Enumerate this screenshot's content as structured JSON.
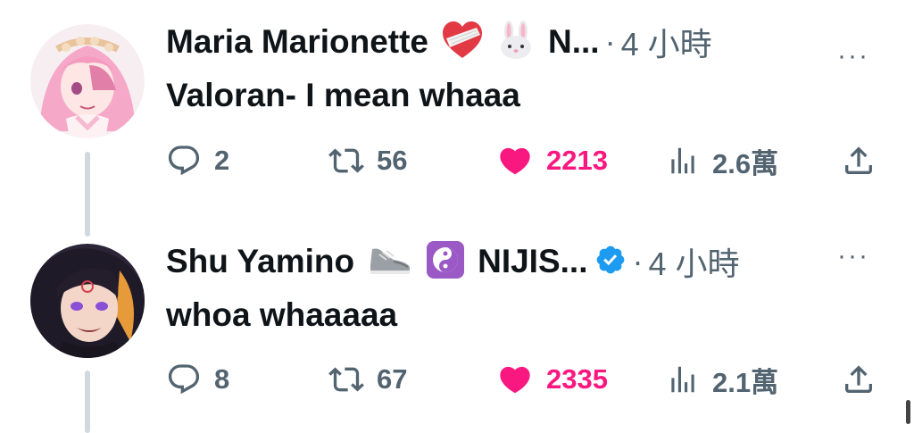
{
  "colors": {
    "like": "#f91880",
    "muted": "#536471",
    "verified": "#1d9bf0",
    "text": "#0f1419"
  },
  "tweets": [
    {
      "author": "Maria Marionette",
      "handle_truncated": "N...",
      "separator": "·",
      "time": "4 小時",
      "text": "Valoran- I mean whaaa",
      "reply_count": "2",
      "retweet_count": "56",
      "like_count": "2213",
      "view_count": "2.6萬",
      "more": "···",
      "name_emojis": [
        "heart-bandaged-emoji",
        "rabbit-face-emoji"
      ]
    },
    {
      "author": "Shu Yamino",
      "handle_truncated": "NIJIS...",
      "separator": "·",
      "time": "4 小時",
      "text": "whoa whaaaaa",
      "reply_count": "8",
      "retweet_count": "67",
      "like_count": "2335",
      "view_count": "2.1萬",
      "more": "···",
      "name_emojis": [
        "sneaker-emoji",
        "yin-yang-emoji"
      ],
      "verified": true
    }
  ]
}
